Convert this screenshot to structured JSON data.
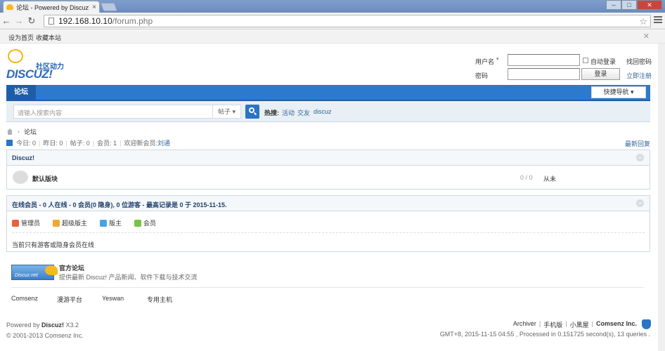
{
  "browser": {
    "tab_title": "论坛 - Powered by Discuz!",
    "url_host": "192.168.10.10",
    "url_path": "/forum.php"
  },
  "topbar": {
    "set_home": "设为首页",
    "bookmark": "收藏本站"
  },
  "header": {
    "logo_slogan": "社区动力",
    "logo_text": "DISCUZ!"
  },
  "login": {
    "username_label": "用户名",
    "password_label": "密码",
    "remember_label": "自动登录",
    "forgot_link": "找回密码",
    "login_button": "登录",
    "register_link": "立即注册"
  },
  "nav": {
    "forum_tab": "论坛",
    "quick_nav": "快捷导航"
  },
  "search": {
    "placeholder": "请输入搜索内容",
    "type": "帖子",
    "hot_label": "热搜:",
    "hot_links": [
      "活动",
      "交友",
      "discuz"
    ]
  },
  "breadcrumb": {
    "current": "论坛"
  },
  "stats": {
    "today": "今日: 0",
    "yesterday": "昨日: 0",
    "posts": "帖子: 0",
    "members": "会员: 1",
    "welcome_prefix": "欢迎新会员: ",
    "new_member": "刘通",
    "latest_link": "最新回复"
  },
  "forum_section": {
    "title": "Discuz!",
    "forum_name": "默认版块",
    "counts": "0 / 0",
    "last_post": "从未"
  },
  "online": {
    "title": "在线会员 - 0 人在线 - 0 会员(0 隐身), 0 位游客 - 最高记录是 0 于 2015-11-15.",
    "legend": [
      {
        "label": "管理员",
        "color": "#e8603c"
      },
      {
        "label": "超级版主",
        "color": "#f0a830"
      },
      {
        "label": "版主",
        "color": "#4aa3df"
      },
      {
        "label": "会员",
        "color": "#7cc242"
      }
    ],
    "note": "当前只有游客或隐身会员在线"
  },
  "partner": {
    "logo_text": "Discuz.net",
    "title": "官方论坛",
    "desc": "提供最新 Discuz! 产品新闻、软件下载与技术交流",
    "links": [
      "Comsenz",
      "漫游平台",
      "Yeswan",
      "专用主机"
    ]
  },
  "footer": {
    "powered_prefix": "Powered by ",
    "powered_brand": "Discuz!",
    "powered_version": " X3.2",
    "copyright": "© 2001-2013 Comsenz Inc.",
    "links": [
      "Archiver",
      "手机版",
      "小黑屋"
    ],
    "brand": "Comsenz Inc.",
    "debug": "GMT+8, 2015-11-15 04:55 , Processed in 0.151725 second(s), 13 queries ."
  }
}
